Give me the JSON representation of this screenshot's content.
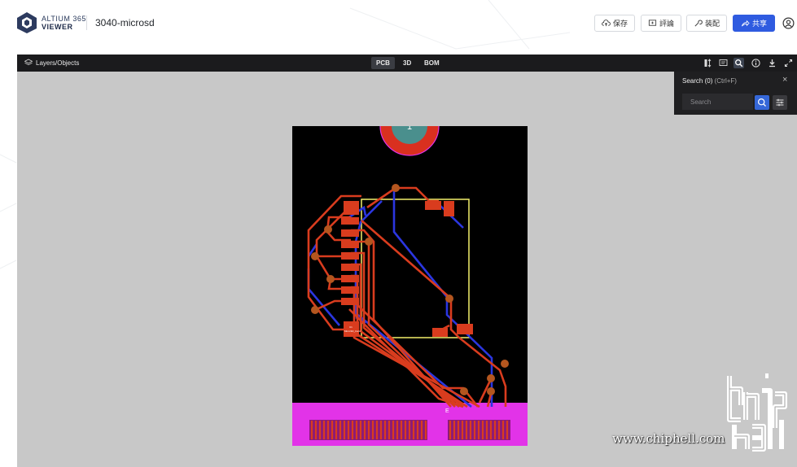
{
  "brand": {
    "line1": "ALTIUM 365",
    "line2": "VIEWER"
  },
  "document": {
    "title": "3040-microsd"
  },
  "header_actions": [
    {
      "label": "保存",
      "icon": "cloud-upload-icon"
    },
    {
      "label": "評論",
      "icon": "comment-icon"
    },
    {
      "label": "装配",
      "icon": "wrench-icon"
    },
    {
      "label": "共享",
      "icon": "share-icon"
    }
  ],
  "viewer": {
    "layers_label": "Layers/Objects",
    "tabs": [
      "PCB",
      "3D",
      "BOM"
    ],
    "active_tab": "PCB",
    "search_panel": {
      "title": "Search",
      "count": "(0)",
      "shortcut": "(Ctrl+F)",
      "placeholder": "Search",
      "close": "×"
    }
  },
  "pcb": {
    "marker_label": "1",
    "component_label": "E",
    "designator_small_1": "U1",
    "designator_small_2": "MicroSD_Card"
  },
  "watermark": {
    "text": "www.chiphell.com"
  },
  "colors": {
    "accent": "#2f5be0",
    "pcb_background": "#000000",
    "trace_top": "#d93c1e",
    "trace_bottom": "#2b36e0",
    "silkscreen": "#f2f06a",
    "edge_connector": "#e233e8",
    "marker_ring": "#d9301f",
    "marker_fill": "#4a8f8d"
  }
}
